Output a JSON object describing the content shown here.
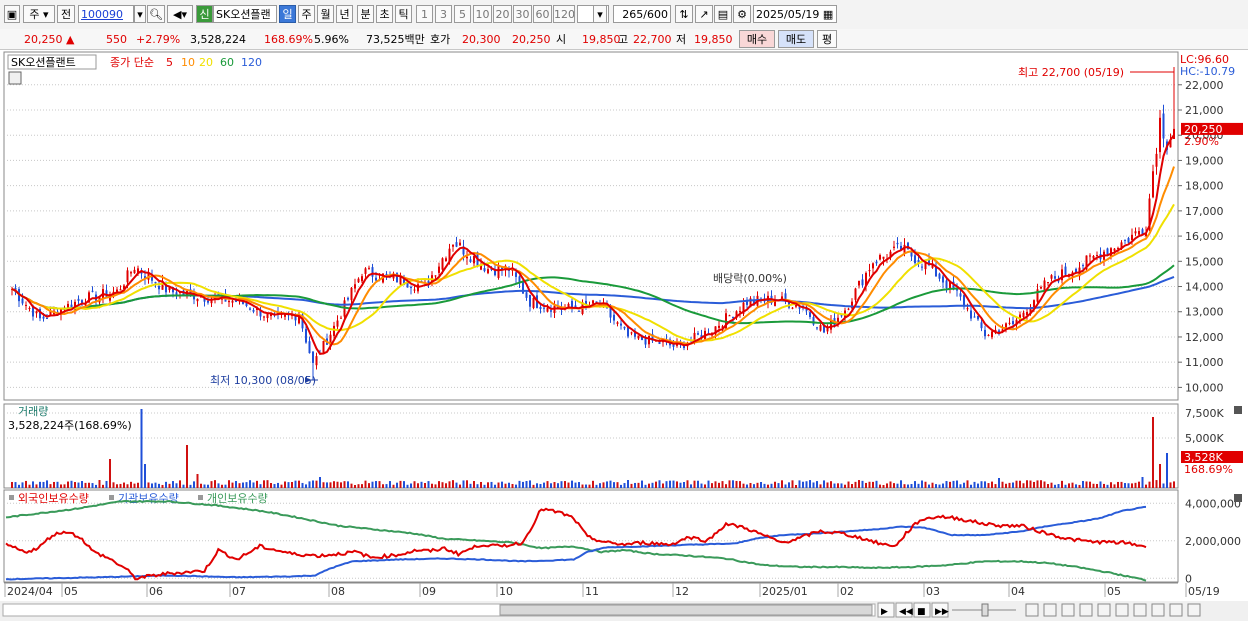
{
  "toolbar": {
    "period_select": "주",
    "prev_label": "전",
    "code": "100090",
    "stock_badge": "신",
    "stock_name": "SK오션플랜",
    "periods": [
      "일",
      "주",
      "월",
      "년",
      "분",
      "초",
      "틱"
    ],
    "active_period": "일",
    "intervals": [
      "1",
      "3",
      "5",
      "10",
      "20",
      "30",
      "60",
      "120"
    ],
    "count": "265",
    "count_max": "/600",
    "date": "2025/05/19"
  },
  "quote": {
    "price": "20,250",
    "change": "550",
    "change_pct": "+2.79%",
    "volume": "3,528,224",
    "volume_ratio": "168.69%",
    "turnover": "5.96%",
    "amount": "73,525백만",
    "ask_label": "호가",
    "ask": "20,300",
    "bid": "20,250",
    "open_label": "시",
    "open": "19,850",
    "high_label": "고",
    "high": "22,700",
    "low_label": "저",
    "low": "19,850",
    "buy_button": "매수",
    "sell_button": "매도",
    "eval_button": "평"
  },
  "colors": {
    "up": "#e00000",
    "down": "#1f4fd8",
    "ma5": "#e00000",
    "ma10": "#ff8c00",
    "ma20": "#f0e000",
    "ma60": "#1a9a3a",
    "ma120": "#2a5cd8",
    "vol_up": "#d01010",
    "vol_down": "#1f4fd8",
    "foreign": "#e00000",
    "institution": "#2a5cd8",
    "individual": "#3a9a5a"
  },
  "chart_data": [
    {
      "type": "candlestick",
      "title": "SK오션플랜트",
      "legend": {
        "price_label": "종가 단순",
        "ma_periods": [
          "5",
          "10",
          "20",
          "60",
          "120"
        ]
      },
      "lc_label": "LC:96.60",
      "hc_label": "HC:-10.79",
      "ylim": [
        9500,
        23300
      ],
      "yticks": [
        10000,
        11000,
        12000,
        13000,
        14000,
        15000,
        16000,
        17000,
        18000,
        19000,
        20000,
        21000,
        22000
      ],
      "ytick_labels": [
        "10,000",
        "11,000",
        "12,000",
        "13,000",
        "14,000",
        "15,000",
        "16,000",
        "17,000",
        "18,000",
        "19,000",
        "20,000",
        "21,000",
        "22,000"
      ],
      "x_start": "2024/04",
      "x_end": "2025/05/19",
      "x_labels": [
        "2024/04",
        "05",
        "06",
        "07",
        "08",
        "09",
        "10",
        "11",
        "12",
        "2025/01",
        "02",
        "03",
        "04",
        "05",
        "05/19"
      ],
      "anchor_closes": [
        [
          0,
          13900
        ],
        [
          8,
          12700
        ],
        [
          20,
          13500
        ],
        [
          30,
          13800
        ],
        [
          35,
          14800
        ],
        [
          45,
          13800
        ],
        [
          55,
          13600
        ],
        [
          65,
          13400
        ],
        [
          75,
          12700
        ],
        [
          82,
          12900
        ],
        [
          86,
          10900
        ],
        [
          92,
          12400
        ],
        [
          100,
          14600
        ],
        [
          110,
          14300
        ],
        [
          118,
          14000
        ],
        [
          126,
          15800
        ],
        [
          136,
          14700
        ],
        [
          142,
          14700
        ],
        [
          148,
          13400
        ],
        [
          158,
          13100
        ],
        [
          168,
          13300
        ],
        [
          176,
          12000
        ],
        [
          184,
          11800
        ],
        [
          190,
          11600
        ],
        [
          200,
          12300
        ],
        [
          210,
          13400
        ],
        [
          218,
          13500
        ],
        [
          226,
          13200
        ],
        [
          232,
          12200
        ],
        [
          238,
          13100
        ],
        [
          246,
          15000
        ],
        [
          254,
          15500
        ],
        [
          262,
          14800
        ],
        [
          270,
          13700
        ],
        [
          278,
          12100
        ],
        [
          286,
          12500
        ],
        [
          296,
          14200
        ],
        [
          306,
          14900
        ],
        [
          312,
          15400
        ],
        [
          318,
          15800
        ],
        [
          324,
          16400
        ],
        [
          326,
          18600
        ],
        [
          328,
          20600
        ],
        [
          330,
          19700
        ],
        [
          332,
          20250
        ]
      ],
      "high_annotation": "최고 22,700 (05/19)",
      "low_annotation": "최저 10,300 (08/05)",
      "dividend_annotation": "배당락(0.00%)",
      "last_price_label": "20,250",
      "last_change_label": "2.90%"
    },
    {
      "type": "bar",
      "title": "거래량",
      "subtitle": "3,528,224주(168.69%)",
      "ylim": [
        0,
        8200000
      ],
      "ytick_labels": [
        "7,500K",
        "5,000K"
      ],
      "yticks": [
        7500000,
        5000000
      ],
      "last_value_label": "3,528K",
      "last_ratio_label": "168.69%",
      "spikes": [
        [
          28,
          2900000
        ],
        [
          37,
          7900000
        ],
        [
          38,
          2400000
        ],
        [
          50,
          4300000
        ],
        [
          53,
          1400000
        ],
        [
          88,
          1100000
        ],
        [
          147,
          700000
        ],
        [
          214,
          600000
        ],
        [
          282,
          1000000
        ],
        [
          323,
          1100000
        ],
        [
          326,
          7100000
        ],
        [
          328,
          2400000
        ],
        [
          330,
          3500000
        ]
      ]
    },
    {
      "type": "line",
      "series_names": [
        "외국인보유수량",
        "기관보유수량",
        "개인보유수량"
      ],
      "ylim": [
        -200000,
        4600000
      ],
      "yticks": [
        4000000,
        2000000,
        0
      ],
      "ytick_labels": [
        "4,000,000",
        "2,000,000",
        "0"
      ],
      "foreign_anchors": [
        [
          0,
          1800000
        ],
        [
          8,
          1400000
        ],
        [
          14,
          1600000
        ],
        [
          20,
          2300000
        ],
        [
          26,
          2500000
        ],
        [
          32,
          2200000
        ],
        [
          38,
          1400000
        ],
        [
          44,
          1100000
        ],
        [
          52,
          500000
        ],
        [
          56,
          0
        ],
        [
          70,
          250000
        ],
        [
          86,
          400000
        ],
        [
          92,
          1500000
        ],
        [
          100,
          1000000
        ],
        [
          110,
          1700000
        ],
        [
          124,
          1300000
        ],
        [
          136,
          1200000
        ],
        [
          152,
          1400000
        ],
        [
          158,
          1100000
        ],
        [
          170,
          1250000
        ],
        [
          178,
          1500000
        ],
        [
          184,
          1450000
        ],
        [
          190,
          1600000
        ],
        [
          196,
          1300000
        ],
        [
          206,
          1800000
        ],
        [
          214,
          1700000
        ],
        [
          224,
          1900000
        ],
        [
          232,
          3700000
        ],
        [
          240,
          3500000
        ],
        [
          246,
          3200000
        ],
        [
          252,
          2200000
        ],
        [
          260,
          1900000
        ],
        [
          268,
          1800000
        ],
        [
          276,
          1900000
        ],
        [
          288,
          1800000
        ],
        [
          296,
          2200000
        ],
        [
          304,
          2000000
        ],
        [
          312,
          2900000
        ],
        [
          320,
          2700000
        ],
        [
          328,
          2300000
        ],
        [
          336,
          1900000
        ],
        [
          343,
          2100000
        ],
        [
          352,
          2500000
        ],
        [
          362,
          2400000
        ],
        [
          372,
          2100000
        ],
        [
          380,
          1800000
        ],
        [
          386,
          1750000
        ],
        [
          390,
          2400000
        ],
        [
          396,
          3100000
        ],
        [
          404,
          3300000
        ],
        [
          412,
          3200000
        ],
        [
          424,
          2900000
        ],
        [
          432,
          2800000
        ],
        [
          440,
          2800000
        ],
        [
          448,
          2500000
        ],
        [
          460,
          2100000
        ],
        [
          470,
          1950000
        ],
        [
          484,
          1900000
        ],
        [
          494,
          1700000
        ]
      ],
      "institution_anchors": [
        [
          0,
          -50000
        ],
        [
          40,
          50000
        ],
        [
          70,
          150000
        ],
        [
          100,
          50000
        ],
        [
          124,
          100000
        ],
        [
          134,
          150000
        ],
        [
          140,
          500000
        ],
        [
          150,
          900000
        ],
        [
          170,
          1000000
        ],
        [
          190,
          1050000
        ],
        [
          206,
          1000000
        ],
        [
          224,
          900000
        ],
        [
          236,
          950000
        ],
        [
          246,
          1000000
        ],
        [
          252,
          1400000
        ],
        [
          260,
          1650000
        ],
        [
          276,
          1700000
        ],
        [
          300,
          1800000
        ],
        [
          316,
          1850000
        ],
        [
          324,
          2100000
        ],
        [
          336,
          2300000
        ],
        [
          352,
          2400000
        ],
        [
          364,
          2500000
        ],
        [
          376,
          2600000
        ],
        [
          388,
          2750000
        ],
        [
          398,
          2700000
        ],
        [
          410,
          2300000
        ],
        [
          424,
          2300000
        ],
        [
          440,
          2500000
        ],
        [
          452,
          2800000
        ],
        [
          464,
          3000000
        ],
        [
          474,
          3200000
        ],
        [
          484,
          3600000
        ],
        [
          494,
          3800000
        ]
      ],
      "individual_anchors": [
        [
          0,
          3250000
        ],
        [
          30,
          3700000
        ],
        [
          50,
          4100000
        ],
        [
          70,
          4100000
        ],
        [
          90,
          3900000
        ],
        [
          110,
          3600000
        ],
        [
          124,
          3300000
        ],
        [
          134,
          3050000
        ],
        [
          144,
          2800000
        ],
        [
          160,
          2600000
        ],
        [
          176,
          2400000
        ],
        [
          190,
          2100000
        ],
        [
          206,
          2000000
        ],
        [
          220,
          1900000
        ],
        [
          232,
          1600000
        ],
        [
          246,
          1700000
        ],
        [
          258,
          1400000
        ],
        [
          268,
          1500000
        ],
        [
          280,
          1300000
        ],
        [
          296,
          1200000
        ],
        [
          312,
          1050000
        ],
        [
          328,
          700000
        ],
        [
          344,
          600000
        ],
        [
          360,
          600000
        ],
        [
          376,
          550000
        ],
        [
          392,
          600000
        ],
        [
          408,
          700000
        ],
        [
          424,
          900000
        ],
        [
          440,
          900000
        ],
        [
          452,
          800000
        ],
        [
          464,
          600000
        ],
        [
          478,
          300000
        ],
        [
          494,
          -100000
        ]
      ]
    }
  ]
}
